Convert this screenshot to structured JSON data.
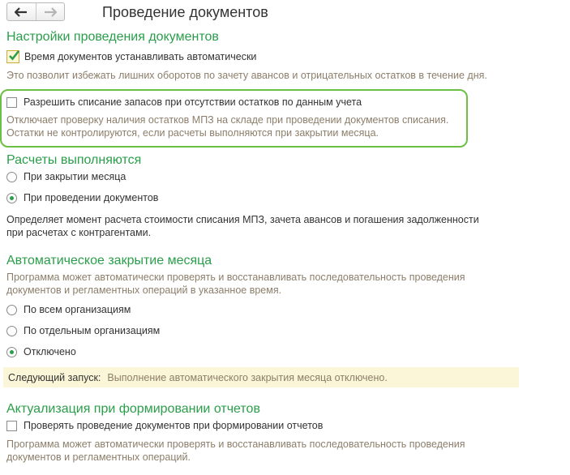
{
  "header": {
    "title": "Проведение документов",
    "back_icon": "arrow-left-icon",
    "forward_icon": "arrow-right-icon"
  },
  "settings": {
    "title": "Настройки проведения документов",
    "auto_time": {
      "label": "Время документов устанавливать автоматически",
      "checked": true,
      "hint": "Это позволит избежать лишних оборотов по зачету авансов и отрицательных остатков в течение дня."
    },
    "allow_writeoff": {
      "label": "Разрешить списание запасов при отсутствии остатков по данным учета",
      "checked": false,
      "hint_line1": "Отключает проверку наличия остатков МПЗ на складе при проведении документов списания.",
      "hint_line2": "Остатки не контролируются, если расчеты выполняются при закрытии месяца."
    }
  },
  "calculations": {
    "title": "Расчеты выполняются",
    "options": [
      {
        "label": "При закрытии месяца",
        "selected": false
      },
      {
        "label": "При проведении документов",
        "selected": true
      }
    ],
    "description_line1": "Определяет момент расчета стоимости списания МПЗ, зачета авансов и погашения задолженности",
    "description_line2": "при расчетах с контрагентами."
  },
  "auto_close": {
    "title": "Автоматическое закрытие месяца",
    "hint_line1": "Программа может автоматически проверять и восстанавливать последовательность проведения",
    "hint_line2": "документов и регламентных операций в указанное время.",
    "options": [
      {
        "label": "По всем организациям",
        "selected": false
      },
      {
        "label": "По отдельным организациям",
        "selected": false
      },
      {
        "label": "Отключено",
        "selected": true
      }
    ],
    "next_run_label": "Следующий запуск:",
    "next_run_value": "Выполнение автоматического закрытия месяца отключено."
  },
  "reports": {
    "title": "Актуализация при формировании отчетов",
    "check": {
      "label": "Проверять проведение документов при формировании отчетов",
      "checked": false
    },
    "hint_line1": "Программа может автоматически проверять и восстанавливать последовательность проведения",
    "hint_line2": "документов и регламентных операций."
  },
  "colors": {
    "accent_green": "#2a9e4a",
    "highlight_border": "#6cbf45",
    "hint_text": "#8c7e6a",
    "next_run_bg": "#fbf6d7"
  }
}
